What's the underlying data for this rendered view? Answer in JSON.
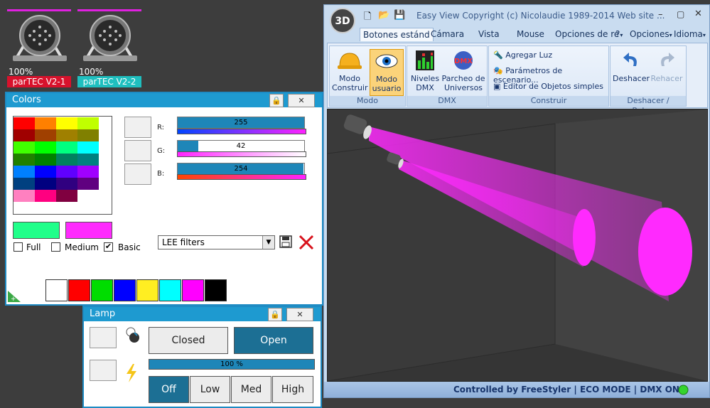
{
  "fixtures": [
    {
      "percent": "100%",
      "name": "parTEC V2-1",
      "color": "#d8122c"
    },
    {
      "percent": "100%",
      "name": "parTEC V2-2",
      "color": "#1fbfbf"
    }
  ],
  "colors_panel": {
    "title": "Colors",
    "grid_colors": [
      [
        "#ff0000",
        "#ff8000",
        "#ffff00",
        "#c0ff00"
      ],
      [
        "#a00000",
        "#a04000",
        "#a08000",
        "#808000"
      ],
      [
        "#40ff00",
        "#00ff00",
        "#00ff80",
        "#00ffff"
      ],
      [
        "#208000",
        "#008000",
        "#008060",
        "#008080"
      ],
      [
        "#0080ff",
        "#0000ff",
        "#6000ff",
        "#a000ff"
      ],
      [
        "#004080",
        "#000080",
        "#300080",
        "#600080"
      ],
      [
        "#ff80c0",
        "#ff0080",
        "#800040",
        "#ffffff"
      ]
    ],
    "rgb": {
      "r": {
        "label": "R:",
        "value": "255",
        "fraction": 1.0
      },
      "g": {
        "label": "G:",
        "value": "42",
        "fraction": 0.165
      },
      "b": {
        "label": "B:",
        "value": "254",
        "fraction": 0.996
      }
    },
    "current_color": "#20ff8a",
    "target_color": "#ff2afe",
    "checkboxes": [
      {
        "label": "Full",
        "checked": false
      },
      {
        "label": "Medium",
        "checked": false
      },
      {
        "label": "Basic",
        "checked": true
      }
    ],
    "filter_select": "LEE filters",
    "palette": [
      "#ffffff",
      "#ff0000",
      "#00dd00",
      "#0000ff",
      "#ffee22",
      "#00ffff",
      "#ff00ff",
      "#000000"
    ]
  },
  "lamp_panel": {
    "title": "Lamp",
    "closed_label": "Closed",
    "open_label": "Open",
    "dimmer": {
      "value": "100 %",
      "fraction": 1.0
    },
    "modes": [
      "Off",
      "Low",
      "Med",
      "High"
    ]
  },
  "window": {
    "title": "Easy View   Copyright (c) Nicolaudie 1989-2014   Web site ...",
    "logo": "3D",
    "tabs": [
      "Botones estánd",
      "Cámara",
      "Vista",
      "Mouse",
      "Opciones de re"
    ],
    "help_label": "?",
    "options_label": "Opciones",
    "language_label": "Idioma",
    "groups": {
      "modo": {
        "caption": "Modo",
        "construir": "Modo Construir",
        "usuario": "Modo usuario"
      },
      "dmx": {
        "caption": "DMX",
        "niveles": "Niveles DMX",
        "parcheo": "Parcheo de Universos"
      },
      "construir": {
        "caption": "Construir",
        "items": [
          "Agregar Luz",
          "Parámetros de escenario...",
          "Editor de Objetos simples"
        ]
      },
      "deshacer": {
        "caption": "Deshacer / Rehacer",
        "undo": "Deshacer",
        "redo": "Rehacer"
      }
    },
    "status": "Controlled by FreeStyler   |   ECO MODE   |   DMX ON",
    "beam_color": "#ff2afe"
  }
}
